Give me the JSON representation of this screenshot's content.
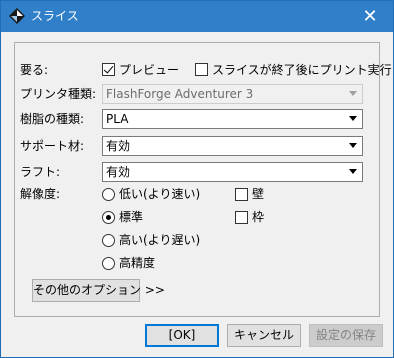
{
  "window": {
    "title": "スライス",
    "close_glyph": "✕"
  },
  "form": {
    "required_label": "要る:",
    "preview_label": "プレビュー",
    "preview_checked": true,
    "print_after_label": "スライスが終了後にプリント実行",
    "print_after_checked": false,
    "printer_type_label": "プリンタ種類:",
    "printer_type_value": "FlashForge Adventurer 3",
    "material_label": "樹脂の種類:",
    "material_value": "PLA",
    "support_label": "サポート材:",
    "support_value": "有効",
    "raft_label": "ラフト:",
    "raft_value": "有効",
    "resolution_label": "解像度:",
    "resolution_options": [
      "低い(より速い)",
      "標準",
      "高い(より遅い)",
      "高精度"
    ],
    "resolution_selected": "標準",
    "wall_label": "壁",
    "fill_label": "枠",
    "more_options_label": "その他のオプション >>"
  },
  "buttons": {
    "ok": "[OK]",
    "cancel": "キャンセル",
    "save_settings": "設定の保存"
  }
}
